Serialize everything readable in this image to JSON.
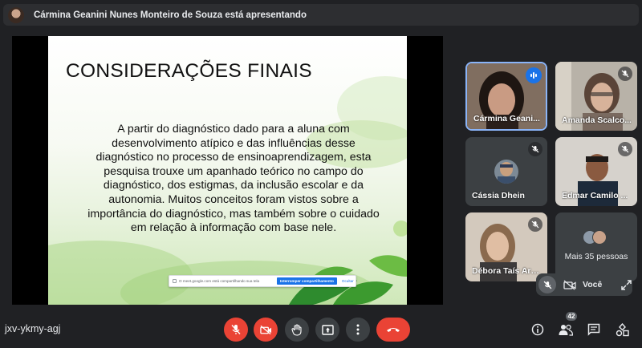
{
  "presenter_bar": {
    "text": "Cármina Geanini Nunes Monteiro de Souza está apresentando"
  },
  "slide": {
    "title": "CONSIDERAÇÕES FINAIS",
    "body": "A partir do diagnóstico dado para a aluna com desenvolvimento atípico e das influências desse diagnóstico no processo de ensinoaprendizagem, esta pesquisa trouxe um apanhado teórico no campo do diagnóstico, dos estigmas, da inclusão escolar e da autonomia. Muitos conceitos foram vistos sobre a importância do diagnóstico, mas também sobre o cuidado em relação à informação com base nele.",
    "share_banner": {
      "message": "O meet.google.com está compartilhando sua tela",
      "stop_label": "Interromper compartilhamento",
      "hide_label": "Ocultar"
    }
  },
  "participants": [
    {
      "name": "Cármina Geani...",
      "speaking": true
    },
    {
      "name": "Amanda Scalco...",
      "muted": true
    },
    {
      "name": "Cássia Dhein",
      "muted": true
    },
    {
      "name": "Edmar Camilo ...",
      "muted": true
    },
    {
      "name": "Débora Taís Arn...",
      "muted": true
    }
  ],
  "more_tile": {
    "label": "Mais 35 pessoas"
  },
  "self_tile": {
    "label": "Você"
  },
  "bottom_bar": {
    "meeting_code": "jxv-ykmy-agj",
    "participant_count": "42"
  },
  "colors": {
    "background": "#202124",
    "tile": "#3c4043",
    "danger": "#ea4335",
    "accent": "#1a73e8"
  },
  "icons": [
    "mic-off-icon",
    "camera-off-icon",
    "hand-raise-icon",
    "present-icon",
    "more-options-icon",
    "end-call-icon",
    "info-icon",
    "people-icon",
    "chat-icon",
    "activities-icon",
    "expand-icon",
    "speaking-icon"
  ]
}
